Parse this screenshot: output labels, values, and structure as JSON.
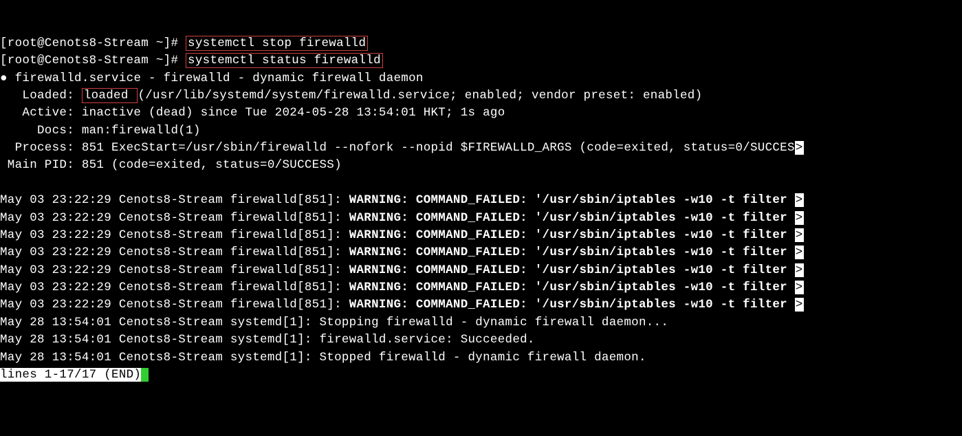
{
  "line1_prompt": "[root@Cenots8-Stream ~]# ",
  "line1_cmd": "systemctl stop firewalld",
  "line2_prompt": "[root@Cenots8-Stream ~]# ",
  "line2_cmd": "systemctl status firewalld",
  "bullet": "●",
  "svc_head": " firewalld.service - firewalld - dynamic firewall daemon",
  "loaded_label": "   Loaded: ",
  "loaded_value": "loaded ",
  "loaded_rest": "(/usr/lib/systemd/system/firewalld.service; enabled; vendor preset: enabled)",
  "active_label": "   Active: inactive (dead) since Tue 2024-05-28 13:54:01 HKT; 1s ago",
  "docs_label": "     Docs: man:firewalld(1)",
  "process_label": "  Process: 851 ExecStart=/usr/sbin/firewalld --nofork --nopid $FIREWALLD_ARGS (code=exited, status=0/SUCCES",
  "mainpid_label": " Main PID: 851 (code=exited, status=0/SUCCESS)",
  "log_prefix": "May 03 23:22:29 Cenots8-Stream firewalld[851]: ",
  "log_warn": "WARNING: COMMAND_FAILED: '/usr/sbin/iptables -w10 -t filter ",
  "log_stop1": "May 28 13:54:01 Cenots8-Stream systemd[1]: Stopping firewalld - dynamic firewall daemon...",
  "log_stop2": "May 28 13:54:01 Cenots8-Stream systemd[1]: firewalld.service: Succeeded.",
  "log_stop3": "May 28 13:54:01 Cenots8-Stream systemd[1]: Stopped firewalld - dynamic firewall daemon.",
  "pager": "lines 1-17/17 (END)",
  "arrow": ">"
}
